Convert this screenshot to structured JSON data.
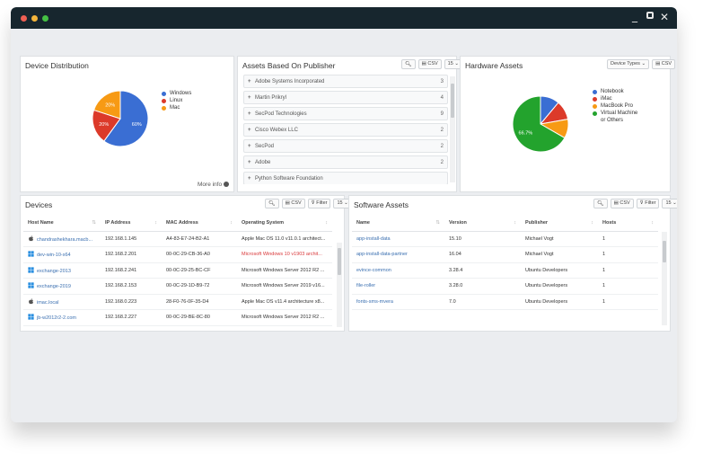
{
  "window": {
    "controls": {
      "minimize": "_",
      "close": "✕"
    }
  },
  "device_distribution": {
    "title": "Device Distribution",
    "more_info": "More info",
    "chart_data": {
      "type": "pie",
      "categories": [
        "Windows",
        "Linux",
        "Mac"
      ],
      "values": [
        60,
        20,
        20
      ],
      "labels": [
        "60%",
        "20%",
        "20%"
      ],
      "colors": [
        "#3a6ed3",
        "#dc3a2a",
        "#f79a14"
      ]
    }
  },
  "publishers": {
    "title": "Assets Based On Publisher",
    "csv": "CSV",
    "page_size": "15",
    "items": [
      {
        "name": "Adobe Systems Incorporated",
        "count": "3"
      },
      {
        "name": "Martin Prikryl",
        "count": "4"
      },
      {
        "name": "SecPod Technologies",
        "count": "9"
      },
      {
        "name": "Cisco Webex LLC",
        "count": "2"
      },
      {
        "name": "SecPod",
        "count": "2"
      },
      {
        "name": "Adobe",
        "count": "2"
      },
      {
        "name": "Python Software Foundation",
        "count": ""
      }
    ]
  },
  "hardware_assets": {
    "title": "Hardware Assets",
    "device_types": "Device Types",
    "csv": "CSV",
    "chart_data": {
      "type": "pie",
      "categories": [
        "Notebook",
        "iMac",
        "MacBook Pro",
        "Virtual Machine or Others"
      ],
      "legend_lines": [
        [
          "Notebook"
        ],
        [
          "iMac"
        ],
        [
          "MacBook Pro"
        ],
        [
          "Virtual Machine",
          "or Others"
        ]
      ],
      "values": [
        11.1,
        11.1,
        11.1,
        66.7
      ],
      "labels": [
        "",
        "",
        "",
        "66.7%"
      ],
      "colors": [
        "#3a6ed3",
        "#dc3a2a",
        "#f79a14",
        "#23a32d"
      ]
    }
  },
  "devices": {
    "title": "Devices",
    "csv": "CSV",
    "filter": "Filter",
    "page_size": "15",
    "columns": [
      "Host Name",
      "IP Address",
      "MAC Address",
      "Operating System"
    ],
    "rows": [
      {
        "os": "apple",
        "host": "chandrashekhara.macb...",
        "ip": "192.168.1.145",
        "mac": "A4-83-E7-24-B2-A1",
        "system": "Apple Mac OS 11.0 v11.0.1 architect..."
      },
      {
        "os": "windows",
        "host": "dev-win-10-x64",
        "ip": "192.168.2.201",
        "mac": "00-0C-29-CB-36-A0",
        "system": "Microsoft Windows 10 v1903 archit..."
      },
      {
        "os": "windows",
        "host": "exchange-2013",
        "ip": "192.168.2.241",
        "mac": "00-0C-29-25-BC-CF",
        "system": "Microsoft Windows Server 2012 R2 ..."
      },
      {
        "os": "windows",
        "host": "exchange-2019",
        "ip": "192.168.2.153",
        "mac": "00-0C-29-1D-B9-72",
        "system": "Microsoft Windows Server 2019 v16..."
      },
      {
        "os": "apple",
        "host": "imac.local",
        "ip": "192.168.0.223",
        "mac": "28-F0-76-0F-35-D4",
        "system": "Apple Mac OS v11.4 architecture x8..."
      },
      {
        "os": "windows",
        "host": "jb-w2012r2-2.com",
        "ip": "192.168.2.227",
        "mac": "00-0C-29-BE-8C-80",
        "system": "Microsoft Windows Server 2012 R2 ..."
      }
    ]
  },
  "software_assets": {
    "title": "Software Assets",
    "csv": "CSV",
    "filter": "Filter",
    "page_size": "15",
    "columns": [
      "Name",
      "Version",
      "Publisher",
      "Hosts"
    ],
    "rows": [
      {
        "name": "app-install-data",
        "version": "15.10",
        "publisher": "Michael Vogt",
        "hosts": "1"
      },
      {
        "name": "app-install-data-partner",
        "version": "16.04",
        "publisher": "Michael Vogt",
        "hosts": "1"
      },
      {
        "name": "evince-common",
        "version": "3.28.4",
        "publisher": "Ubuntu Developers",
        "hosts": "1"
      },
      {
        "name": "file-roller",
        "version": "3.28.0",
        "publisher": "Ubuntu Developers",
        "hosts": "1"
      },
      {
        "name": "fonts-sms-mvera",
        "version": "7.0",
        "publisher": "Ubuntu Developers",
        "hosts": "1"
      }
    ]
  }
}
